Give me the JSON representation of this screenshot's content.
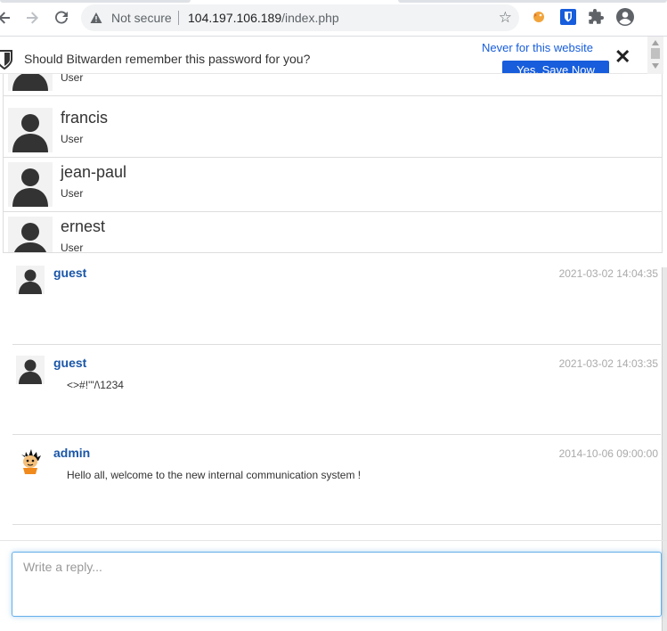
{
  "browser": {
    "not_secure_label": "Not secure",
    "url_host": "104.197.106.189",
    "url_path": "/index.php",
    "back_icon": "arrow-left-icon",
    "forward_icon": "arrow-right-icon",
    "reload_icon": "reload-icon",
    "star_icon": "star-icon",
    "extensions": [
      "hackbar-extension-icon",
      "bitwarden-extension-icon",
      "puzzle-icon",
      "account-icon"
    ]
  },
  "bitwarden": {
    "question": "Should Bitwarden remember this password for you?",
    "never_label": "Never for this website",
    "save_label": "Yes, Save Now",
    "close_label": "✕",
    "brand_color": "#175ddc"
  },
  "users": [
    {
      "name": "",
      "role": "User"
    },
    {
      "name": "francis",
      "role": "User"
    },
    {
      "name": "jean-paul",
      "role": "User"
    },
    {
      "name": "ernest",
      "role": "User"
    }
  ],
  "messages": [
    {
      "user": "guest",
      "time": "2021-03-02 14:04:35",
      "text": "",
      "avatar": "default"
    },
    {
      "user": "guest",
      "time": "2021-03-02 14:03:35",
      "text": "<>#!'\"/\\1234",
      "avatar": "default"
    },
    {
      "user": "admin",
      "time": "2014-10-06 09:00:00",
      "text": "Hello all, welcome to the new internal communication system !",
      "avatar": "custom"
    }
  ],
  "reply": {
    "placeholder": "Write a reply..."
  }
}
